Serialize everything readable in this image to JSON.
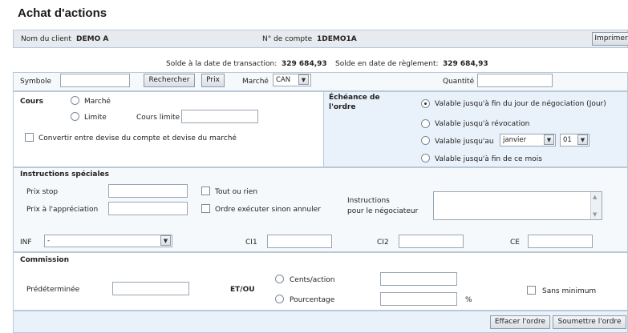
{
  "page_title": "Achat d'actions",
  "client": {
    "name_label": "Nom du client",
    "name_value": "DEMO A",
    "account_label": "N° de compte",
    "account_value": "1DEMO1A",
    "print_label": "Imprimer"
  },
  "balances": {
    "trade_date_label": "Solde à la date de transaction:",
    "trade_date_value": "329 684,93",
    "settlement_label": "Solde en date de règlement:",
    "settlement_value": "329 684,93"
  },
  "symbol_row": {
    "symbol_label": "Symbole",
    "symbol_value": "",
    "search_label": "Rechercher",
    "price_label": "Prix",
    "market_label": "Marché",
    "market_value": "CAN",
    "quantity_label": "Quantité",
    "quantity_value": ""
  },
  "cours": {
    "label": "Cours",
    "market_option": "Marché",
    "limit_option": "Limite",
    "limit_price_label": "Cours limite",
    "limit_price_value": "",
    "convert_label": "Convertir entre devise du compte et devise du marché"
  },
  "expiry": {
    "label_line1": "Échéance de",
    "label_line2": "l'ordre",
    "options": [
      "Valable jusqu'à fin du jour de négociation (Jour)",
      "Valable jusqu'à révocation",
      "Valable jusqu'au",
      "Valable jusqu'à fin de ce mois"
    ],
    "selected_option": 0,
    "month_value": "janvier",
    "day_value": "01"
  },
  "special": {
    "header": "Instructions spéciales",
    "stop_price_label": "Prix stop",
    "stop_price_value": "",
    "appreciation_price_label": "Prix à l'appréciation",
    "appreciation_price_value": "",
    "all_or_none_label": "Tout ou rien",
    "fill_or_kill_label": "Ordre exécuter sinon annuler",
    "trader_instr_line1": "Instructions",
    "trader_instr_line2": "pour le négociateur",
    "trader_instr_value": ""
  },
  "codes": {
    "inf_label": "INF",
    "inf_value": "-",
    "ci1_label": "CI1",
    "ci1_value": "",
    "ci2_label": "CI2",
    "ci2_value": "",
    "ce_label": "CE",
    "ce_value": ""
  },
  "commission": {
    "header": "Commission",
    "predetermined_label": "Prédéterminée",
    "predetermined_value": "",
    "and_or_label": "ET/OU",
    "cents_label": "Cents/action",
    "cents_value": "",
    "percent_label": "Pourcentage",
    "percent_value": "",
    "percent_unit": "%",
    "no_minimum_label": "Sans minimum"
  },
  "actions": {
    "clear_label": "Effacer l'ordre",
    "submit_label": "Soumettre l'ordre"
  }
}
